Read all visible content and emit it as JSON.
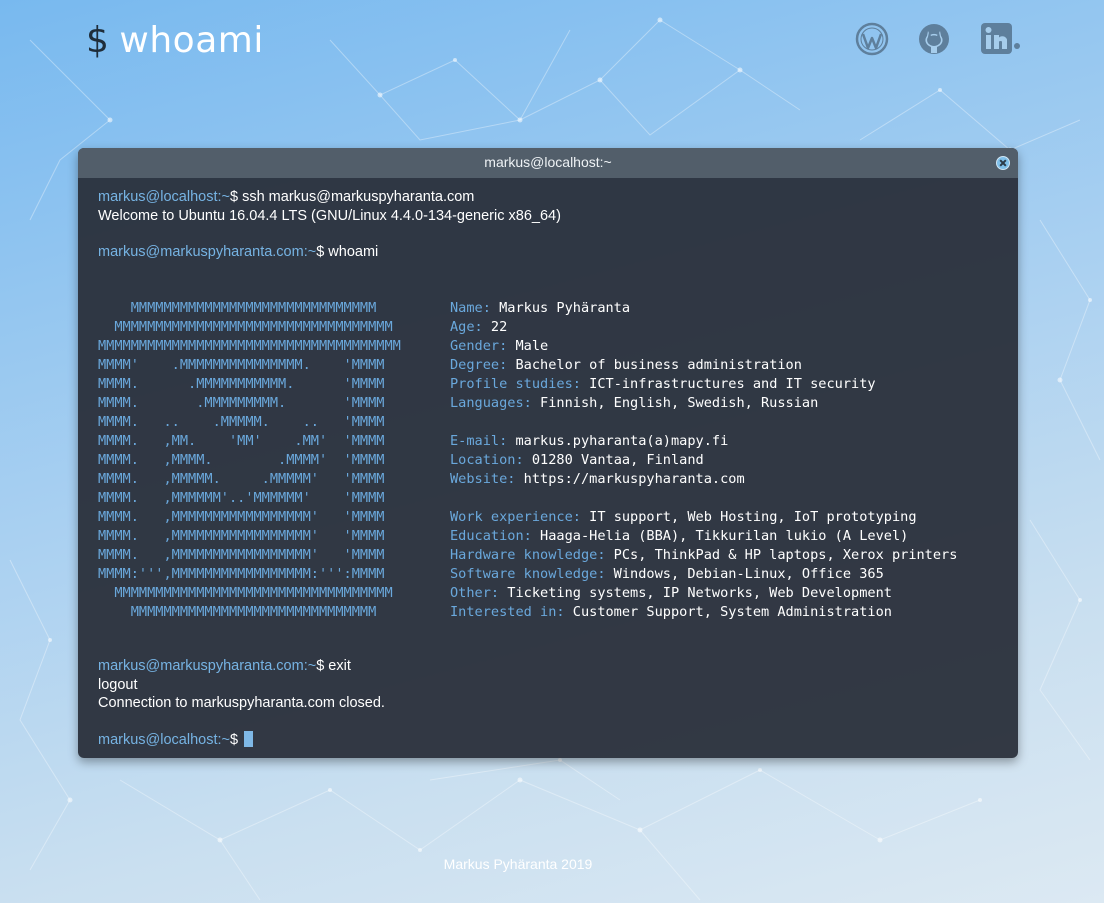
{
  "header": {
    "logo_symbol": "$",
    "logo_text": "whoami",
    "social_icons": [
      "wordpress-icon",
      "github-icon",
      "linkedin-icon"
    ]
  },
  "terminal": {
    "title": "markus@localhost:~",
    "lines": [
      {
        "prompt": "markus@localhost:~",
        "symbol": "$",
        "command": " ssh markus@markuspyharanta.com"
      },
      {
        "output": "Welcome to Ubuntu 16.04.4 LTS (GNU/Linux 4.4.0-134-generic x86_64)"
      },
      {
        "prompt": "markus@markuspyharanta.com:~",
        "symbol": "$",
        "command": " whoami"
      },
      {
        "prompt": "markus@markuspyharanta.com:~",
        "symbol": "$",
        "command": " exit"
      },
      {
        "output": "logout"
      },
      {
        "output": "Connection to markuspyharanta.com closed."
      },
      {
        "prompt": "markus@localhost:~",
        "symbol": "$",
        "command": " "
      }
    ],
    "ascii_art": [
      "    MMMMMMMMMMMMMMMMMMMMMMMMMMMMMM",
      "  MMMMMMMMMMMMMMMMMMMMMMMMMMMMMMMMMM",
      "MMMMMMMMMMMMMMMMMMMMMMMMMMMMMMMMMMMMM",
      "MMMM'    .MMMMMMMMMMMMMMM.    'MMMM",
      "MMMM.      .MMMMMMMMMMM.      'MMMM",
      "MMMM.       .MMMMMMMMM.       'MMMM",
      "MMMM.   ..    .MMMMM.    ..   'MMMM",
      "MMMM.   ,MM.    'MM'    .MM'  'MMMM",
      "MMMM.   ,MMMM.        .MMMM'  'MMMM",
      "MMMM.   ,MMMMM.     .MMMMM'   'MMMM",
      "MMMM.   ,MMMMMM'..'MMMMMM'    'MMMM",
      "MMMM.   ,MMMMMMMMMMMMMMMMM'   'MMMM",
      "MMMM.   ,MMMMMMMMMMMMMMMMM'   'MMMM",
      "MMMM.   ,MMMMMMMMMMMMMMMMM'   'MMMM",
      "MMMM:''',MMMMMMMMMMMMMMMMM:''':MMMM",
      "  MMMMMMMMMMMMMMMMMMMMMMMMMMMMMMMMMM",
      "    MMMMMMMMMMMMMMMMMMMMMMMMMMMMMM"
    ],
    "info": [
      {
        "key": "Name:",
        "value": " Markus Pyhäranta"
      },
      {
        "key": "Age:",
        "value": " 22"
      },
      {
        "key": "Gender:",
        "value": " Male"
      },
      {
        "key": "Degree:",
        "value": " Bachelor of business administration"
      },
      {
        "key": "Profile studies:",
        "value": " ICT-infrastructures and IT security"
      },
      {
        "key": "Languages:",
        "value": " Finnish, English, Swedish, Russian"
      },
      {
        "key": "",
        "value": ""
      },
      {
        "key": "E-mail:",
        "value": " markus.pyharanta(a)mapy.fi"
      },
      {
        "key": "Location:",
        "value": " 01280 Vantaa, Finland"
      },
      {
        "key": "Website:",
        "value": " https://markuspyharanta.com"
      },
      {
        "key": "",
        "value": ""
      },
      {
        "key": "Work experience:",
        "value": " IT support, Web Hosting, IoT prototyping"
      },
      {
        "key": "Education:",
        "value": " Haaga-Helia (BBA), Tikkurilan lukio (A Level)"
      },
      {
        "key": "Hardware knowledge:",
        "value": " PCs, ThinkPad & HP laptops, Xerox printers"
      },
      {
        "key": "Software knowledge:",
        "value": " Windows, Debian-Linux, Office 365"
      },
      {
        "key": "Other:",
        "value": " Ticketing systems, IP Networks, Web Development"
      },
      {
        "key": "Interested in:",
        "value": " Customer Support, System Administration"
      }
    ]
  },
  "footer": {
    "text": "Markus Pyhäranta 2019"
  }
}
